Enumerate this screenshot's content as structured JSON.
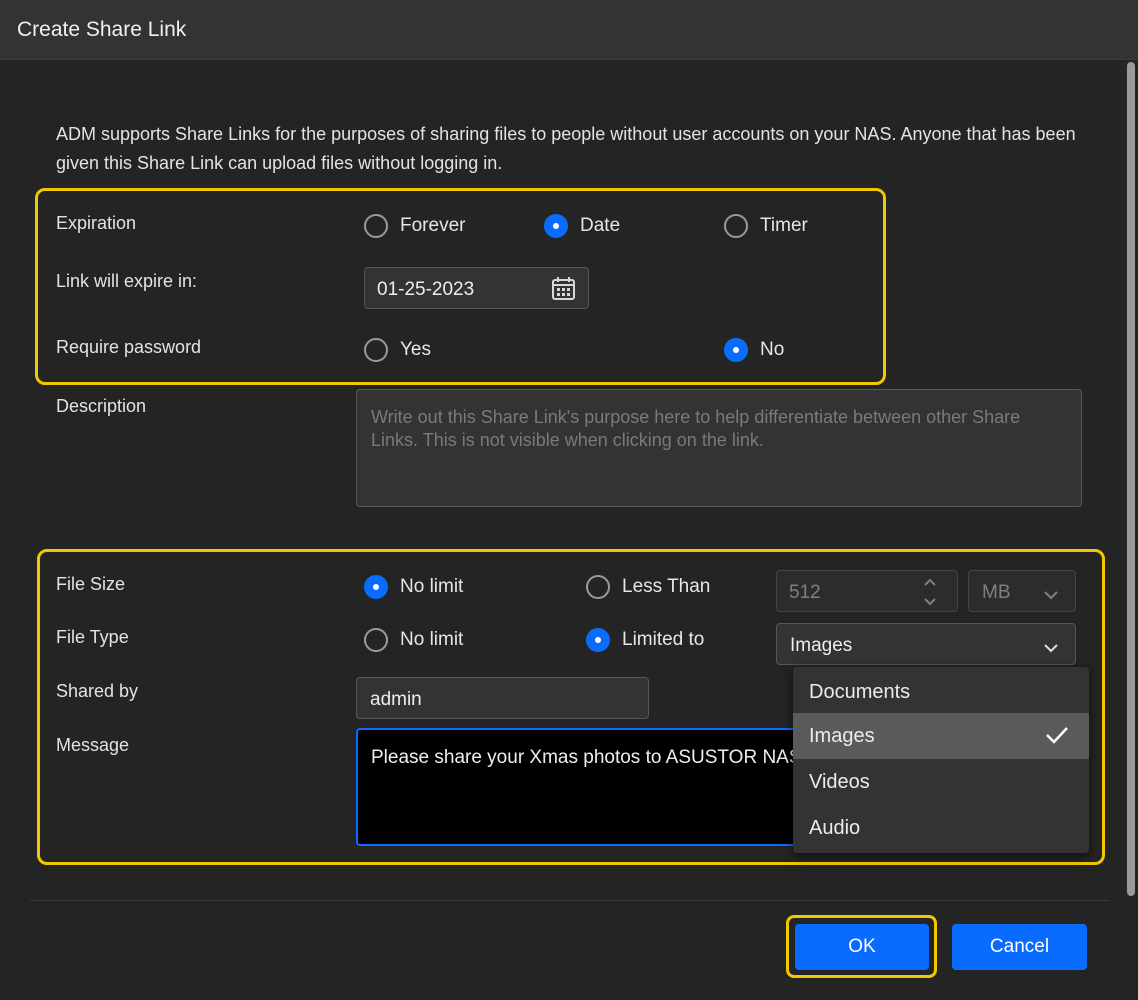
{
  "dialog": {
    "title": "Create Share Link",
    "intro": "ADM supports Share Links for the purposes of sharing files to people without user accounts on your NAS. Anyone that has been given this Share Link can upload files without logging in."
  },
  "expiration": {
    "label": "Expiration",
    "options": [
      "Forever",
      "Date",
      "Timer"
    ],
    "selected": "Date"
  },
  "expire_in": {
    "label": "Link will expire in:",
    "value": "01-25-2023",
    "icon": "calendar-icon"
  },
  "password": {
    "label": "Require password",
    "options": [
      "Yes",
      "No"
    ],
    "selected": "No"
  },
  "description": {
    "label": "Description",
    "placeholder": "Write out this Share Link's purpose here to help differentiate between other Share Links. This is not visible when clicking on the link."
  },
  "file_size": {
    "label": "File Size",
    "options": [
      "No limit",
      "Less Than"
    ],
    "selected": "No limit",
    "size_value": "512",
    "unit": "MB"
  },
  "file_type": {
    "label": "File Type",
    "options": [
      "No limit",
      "Limited to"
    ],
    "selected": "Limited to",
    "dropdown_value": "Images",
    "dropdown_options": [
      "Documents",
      "Images",
      "Videos",
      "Audio"
    ]
  },
  "shared_by": {
    "label": "Shared by",
    "value": "admin"
  },
  "message": {
    "label": "Message",
    "value": "Please share your Xmas photos to ASUSTOR NAS"
  },
  "buttons": {
    "ok": "OK",
    "cancel": "Cancel"
  },
  "colors": {
    "accent": "#0a6cff",
    "highlight": "#f0c800"
  }
}
